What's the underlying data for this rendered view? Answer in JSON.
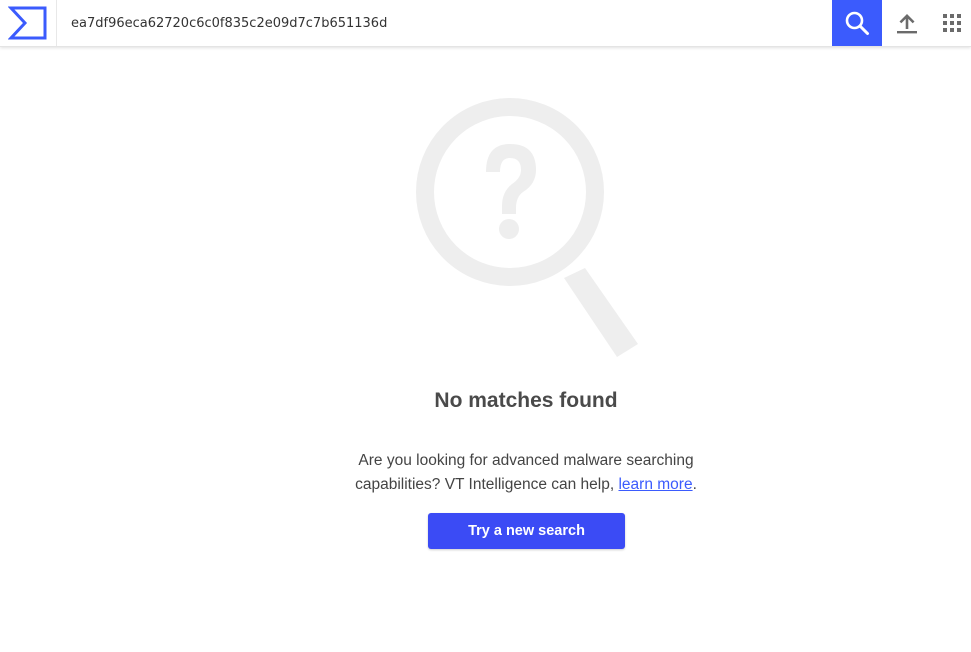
{
  "header": {
    "logo_icon": "virustotal-sigma-logo-icon",
    "search": {
      "value": "ea7df96eca62720c6c0f835c2e09d7c7b651136d",
      "placeholder": ""
    },
    "search_button_icon": "search-icon",
    "upload_icon": "upload-icon",
    "apps_icon": "apps-grid-icon"
  },
  "empty_state": {
    "illustration_icon": "magnifier-question-icon",
    "title": "No matches found",
    "description_prefix": "Are you looking for advanced malware searching capabilities? VT Intelligence can help, ",
    "link_text": "learn more",
    "description_suffix": ".",
    "button_label": "Try a new search"
  },
  "colors": {
    "accent": "#3b5bfd",
    "button": "#3b4bf5",
    "illustration": "#eeeeee",
    "text": "#444444"
  }
}
